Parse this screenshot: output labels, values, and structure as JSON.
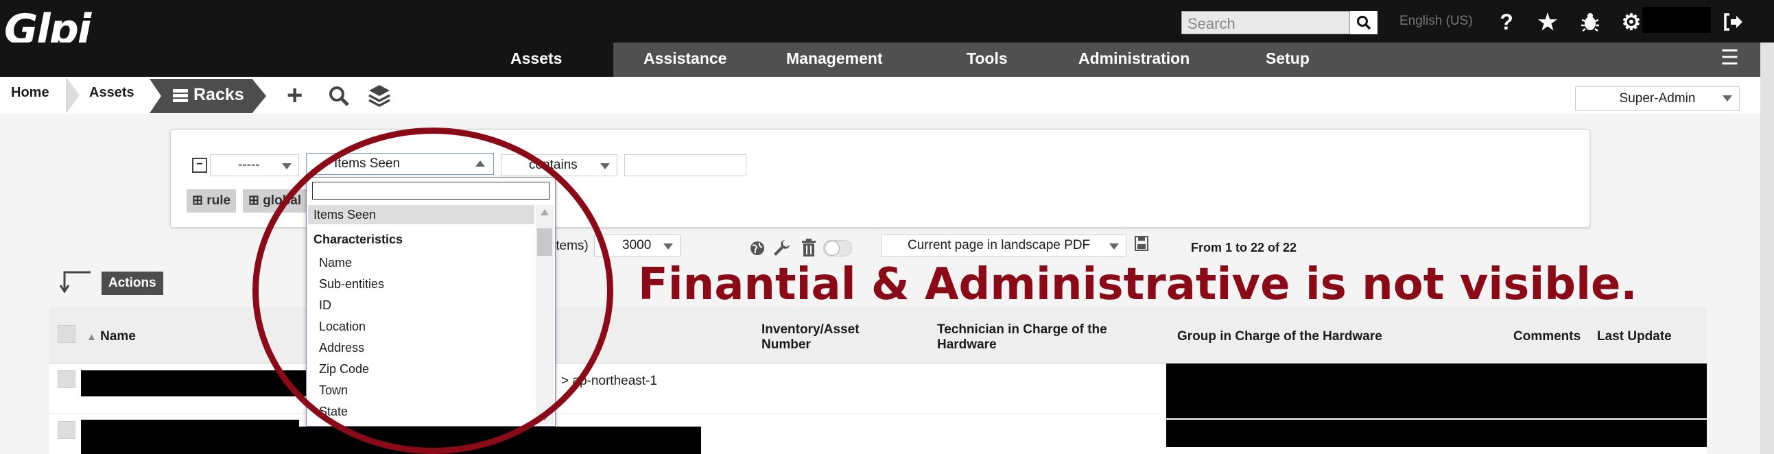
{
  "app": {
    "logo_text": "Glpi"
  },
  "header": {
    "search_placeholder": "Search",
    "language": "English (US)",
    "icons": [
      "help-icon",
      "star-icon",
      "bug-icon",
      "gear-icon",
      "logout-icon"
    ]
  },
  "nav": {
    "items": [
      "Assets",
      "Assistance",
      "Management",
      "Tools",
      "Administration",
      "Setup"
    ],
    "active": "Assets"
  },
  "breadcrumb": {
    "home": "Home",
    "assets": "Assets",
    "current": "Racks"
  },
  "profile": {
    "value": "Super-Admin"
  },
  "criteria": {
    "link_select": "-----",
    "field_select": "Items Seen",
    "operator_select": "contains",
    "value": "",
    "rule_label": "rule",
    "global_label": "global"
  },
  "dropdown": {
    "search_value": "",
    "selected": "Items Seen",
    "group": "Characteristics",
    "options": [
      "Name",
      "Sub-entities",
      "ID",
      "Location",
      "Address",
      "Zip Code",
      "Town",
      "State"
    ]
  },
  "toolbar": {
    "items_suffix": "items)",
    "per_page": "3000",
    "export_format": "Current page in landscape PDF",
    "pagination": "From 1 to 22 of 22",
    "actions_label": "Actions"
  },
  "table": {
    "columns": [
      "Name",
      "Inventory/Asset Number",
      "Technician in Charge of the Hardware",
      "Group in Charge of the Hardware",
      "Comments",
      "Last Update"
    ],
    "rows": [
      {
        "location_fragment": "> ap-northeast-1"
      }
    ]
  },
  "annotation": {
    "text": "Finantial & Administrative is not visible."
  },
  "colors": {
    "annotation": "#8b0a17",
    "topbar": "#141414",
    "navbar_grey": "#505050"
  }
}
